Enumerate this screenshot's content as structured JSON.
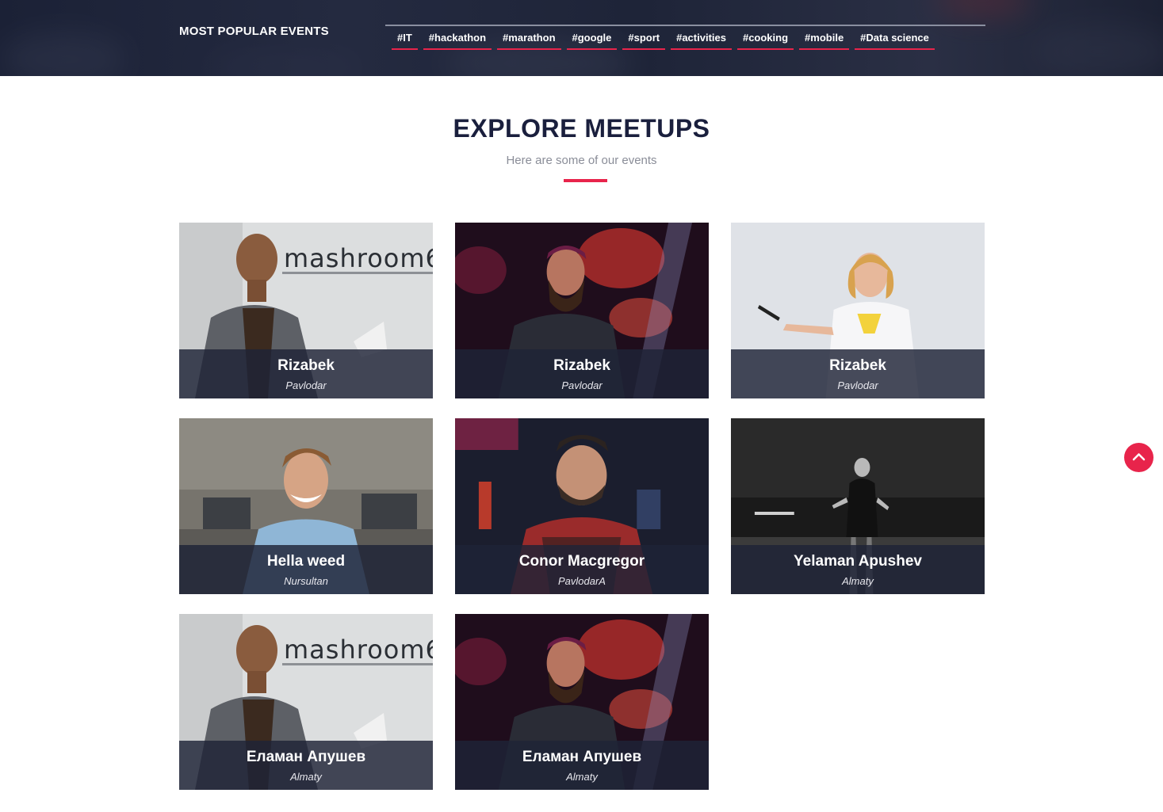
{
  "header": {
    "popular_title": "MOST POPULAR EVENTS",
    "tags": [
      "#IT",
      "#hackathon",
      "#marathon",
      "#google",
      "#sport",
      "#activities",
      "#cooking",
      "#mobile",
      "#Data science"
    ]
  },
  "section": {
    "title": "EXPLORE MEETUPS",
    "subtitle": "Here are some of our events"
  },
  "cards": [
    {
      "name": "Rizabek",
      "city": "Pavlodar",
      "wall_text": "mashroom6"
    },
    {
      "name": "Rizabek",
      "city": "Pavlodar"
    },
    {
      "name": "Rizabek",
      "city": "Pavlodar"
    },
    {
      "name": "Hella weed",
      "city": "Nursultan"
    },
    {
      "name": "Conor Macgregor",
      "city": "PavlodarA"
    },
    {
      "name": "Yelaman Apushev",
      "city": "Almaty"
    },
    {
      "name": "Еламан Апушев",
      "city": "Almaty",
      "wall_text": "mashroom6"
    },
    {
      "name": "Еламан Апушев",
      "city": "Almaty"
    }
  ],
  "colors": {
    "accent": "#e8244b",
    "heading": "#1a1f3d",
    "banner": "#1e2438"
  },
  "icons": {
    "scroll_top": "chevron-up-icon"
  }
}
